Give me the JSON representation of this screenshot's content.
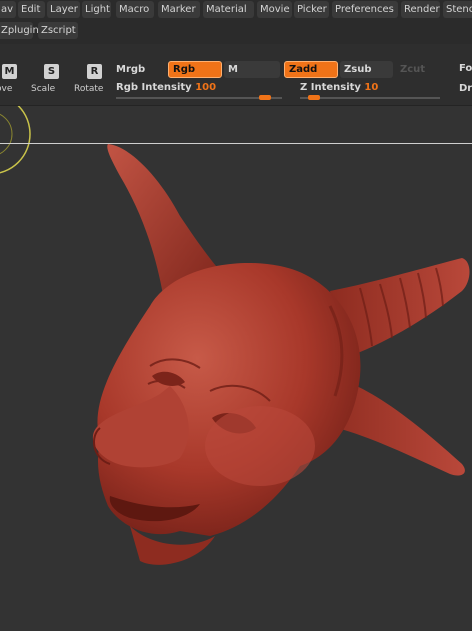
{
  "menu": [
    "av",
    "Edit",
    "Layer",
    "Light",
    "Macro",
    "Marker",
    "Material",
    "Movie",
    "Picker",
    "Preferences",
    "Render",
    "Stenc",
    "Zplugin",
    "Zscript"
  ],
  "tools": {
    "move": {
      "key": "M",
      "label": "ove"
    },
    "scale": {
      "key": "S",
      "label": "Scale"
    },
    "rotate": {
      "key": "R",
      "label": "Rotate"
    }
  },
  "modes": {
    "mrgb": "Mrgb",
    "rgb": "Rgb",
    "m": "M",
    "zadd": "Zadd",
    "zsub": "Zsub",
    "zcut": "Zcut",
    "fo": "Fo",
    "dr": "Dr"
  },
  "sliders": {
    "rgb_intensity": {
      "label": "Rgb Intensity",
      "value": "100",
      "fraction": 0.9
    },
    "z_intensity": {
      "label": "Z Intensity",
      "value": "10",
      "fraction": 0.1
    }
  },
  "colors": {
    "accent": "#f07318",
    "model": "#a8382a",
    "background": "#333333"
  }
}
